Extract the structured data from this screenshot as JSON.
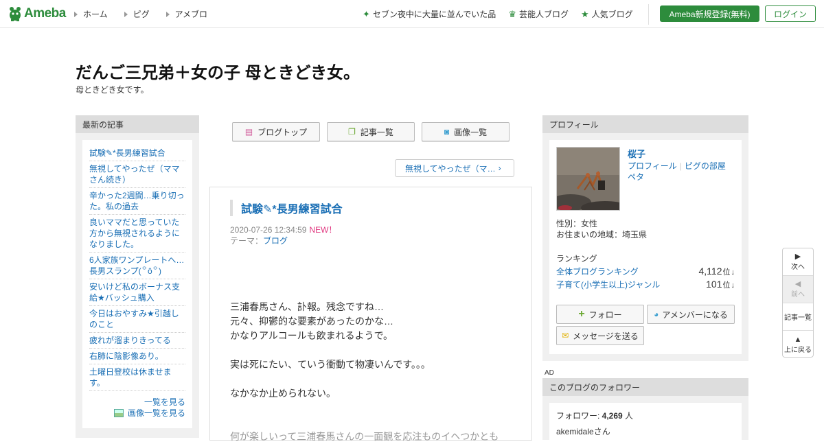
{
  "header": {
    "logo_text": "Ameba",
    "nav": [
      "ホーム",
      "ピグ",
      "アメブロ"
    ],
    "right_links": [
      {
        "icon": "sparkle-icon",
        "label": "セブン夜中に大量に並んでいた品"
      },
      {
        "icon": "crown-icon",
        "label": "芸能人ブログ"
      },
      {
        "icon": "star-icon",
        "label": "人気ブログ"
      }
    ],
    "register_label": "Ameba新規登録(無料)",
    "login_label": "ログイン",
    "brand_color": "#2d8c3c"
  },
  "blog": {
    "title": "だんご三兄弟＋女の子 母ときどき女。",
    "description": "母ときどき女です。"
  },
  "left": {
    "heading": "最新の記事",
    "articles": [
      "試験✎*長男練習試合",
      "無視してやったぜ（ママさん続き）",
      "辛かった2週間…乗り切った。私の過去",
      "良いママだと思っていた方から無視されるようになりました。",
      "6人家族ワンプレートへ…長男スランプ(꒪ȏ꒪)",
      "安いけど私のボーナス支給★バッシュ購入",
      "今日はおやすみ★引越しのこと",
      "疲れが溜まりきってる",
      "右肺に陰影像あり。",
      "土曜日登校は休ませます。"
    ],
    "more_label": "一覧を見る",
    "images_label": "画像一覧を見る"
  },
  "tabs": [
    "ブログトップ",
    "記事一覧",
    "画像一覧"
  ],
  "next_link": "無視してやったぜ（マ…",
  "article": {
    "title": "試験✎*長男練習試合",
    "date": "2020-07-26 12:34:59",
    "new_badge": "NEW！",
    "theme_prefix": "テーマ：",
    "theme": "ブログ",
    "body": [
      "三浦春馬さん、訃報。残念ですね…",
      "元々、抑鬱的な要素があったのかな…",
      "かなりアルコールも飲まれるようで。",
      "",
      "実は死にたい、ていう衝動て物凄いんです。。。",
      "",
      "なかなか止められない。",
      "",
      "",
      "何が楽しいって三浦春馬さんの一面観を応注ものイヘつかとも"
    ]
  },
  "profile": {
    "heading": "プロフィール",
    "name": "桜子",
    "link_profile": "プロフィール",
    "link_pig": "ピグの部屋",
    "link_peta": "ペタ",
    "gender": "性別：女性",
    "location": "お住まいの地域：埼玉県",
    "ranking_heading": "ランキング",
    "rankings": [
      {
        "label": "全体ブログランキング",
        "value": "4,112",
        "unit": "位",
        "trend": "↓"
      },
      {
        "label": "子育て(小学生以上)ジャンル",
        "value": "101",
        "unit": "位",
        "trend": "↓"
      }
    ],
    "follow_label": "フォロー",
    "amember_label": "アメンバーになる",
    "message_label": "メッセージを送る"
  },
  "ad_label": "AD",
  "followers": {
    "heading": "このブログのフォロワー",
    "prefix": "フォロワー: ",
    "count": "4,269",
    "suffix": " 人",
    "first_follower": "akemidaleさん"
  },
  "sidenav": {
    "next": "次へ",
    "prev": "前へ",
    "list": "記事一覧",
    "top": "上に戻る"
  }
}
